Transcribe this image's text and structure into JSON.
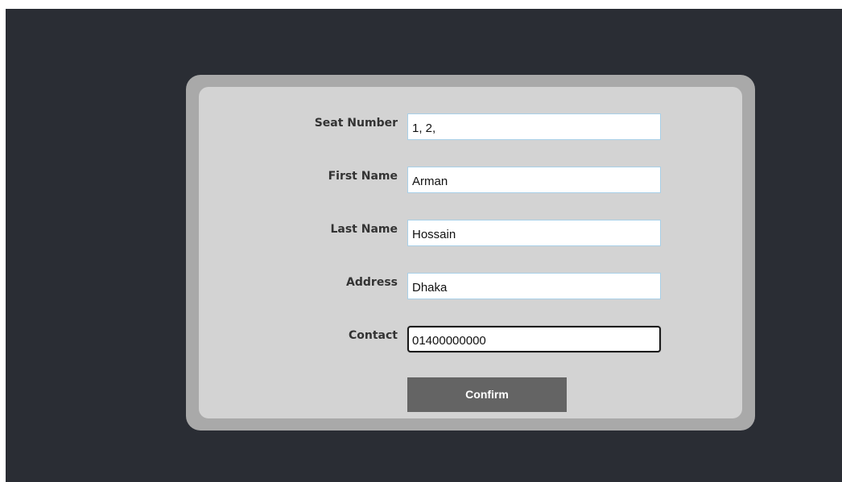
{
  "form": {
    "fields": [
      {
        "label": "Seat Number",
        "value": "1, 2,"
      },
      {
        "label": "First Name",
        "value": "Arman"
      },
      {
        "label": "Last Name",
        "value": "Hossain"
      },
      {
        "label": "Address",
        "value": "Dhaka"
      },
      {
        "label": "Contact",
        "value": "01400000000",
        "focused": true
      }
    ],
    "confirm_label": "Confirm"
  },
  "colors": {
    "background": "#2a2d34",
    "frame": "#a9a9a9",
    "card": "#d3d3d3",
    "button": "#646464",
    "input_border": "#a8d0e8"
  }
}
